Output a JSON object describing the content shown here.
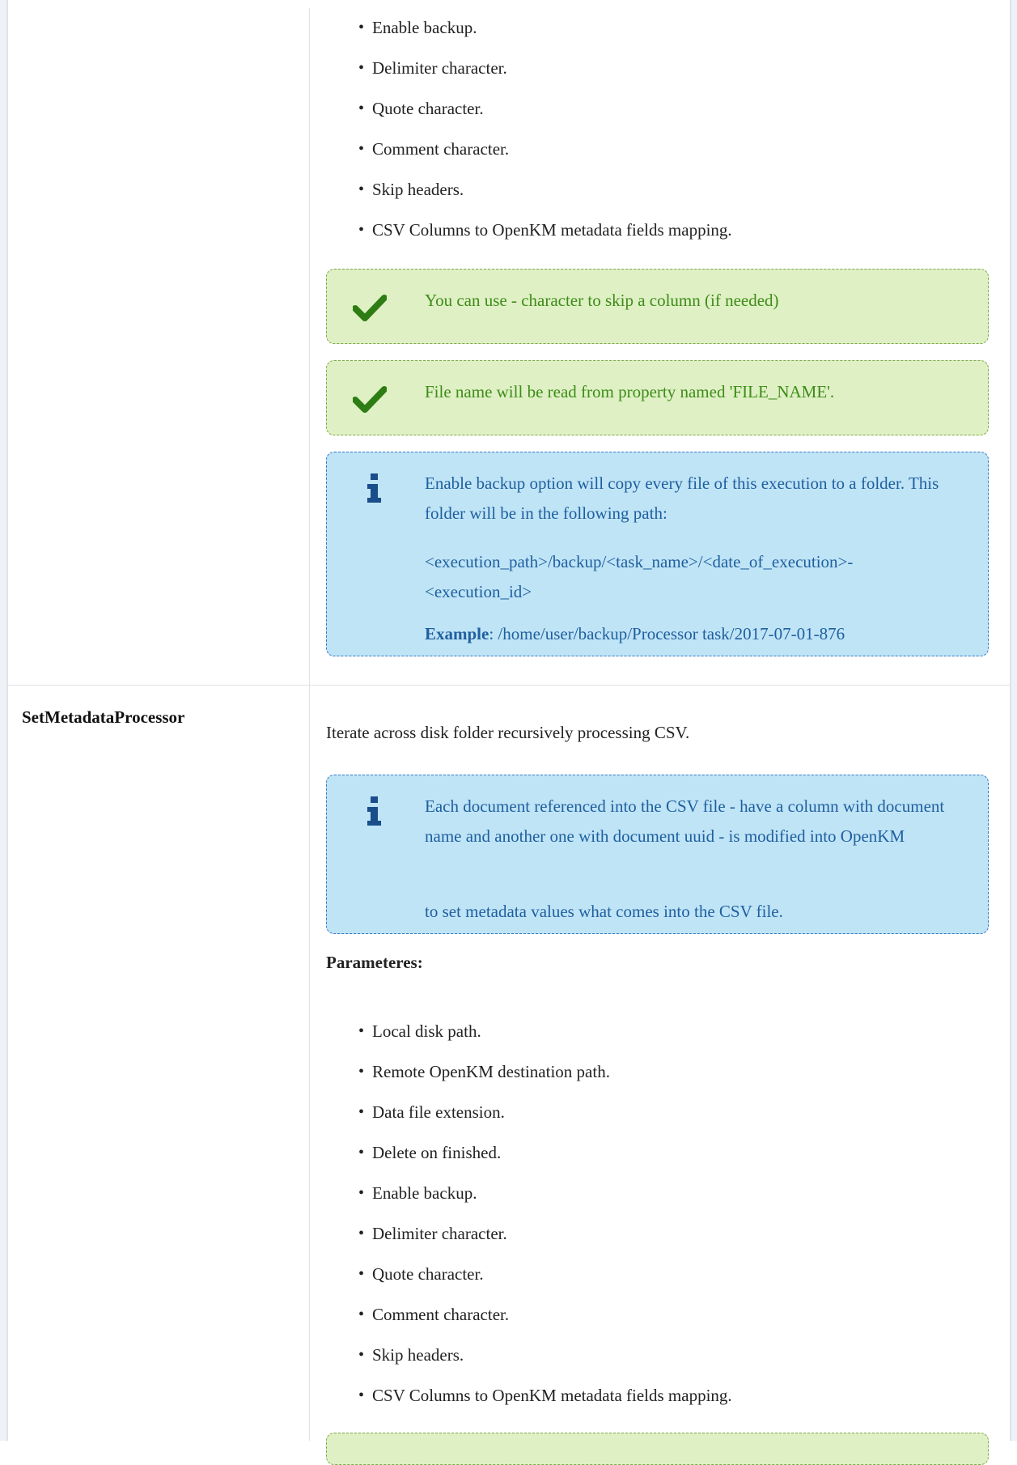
{
  "top_list": [
    "Enable backup.",
    "Delimiter character.",
    "Quote character.",
    "Comment character.",
    "Skip headers.",
    "CSV Columns to OpenKM metadata fields mapping."
  ],
  "notes_top": {
    "success_1": "You can use - character to skip a column (if needed)",
    "success_2": "File name will be read from property named 'FILE_NAME'.",
    "info": {
      "line1": "Enable backup option will copy every file of this execution to a folder. This folder will be in the following path:",
      "line2": "<execution_path>/backup/<task_name>/<date_of_execution>-<execution_id>",
      "example_label": "Example",
      "example_value": ":  /home/user/backup/Processor task/2017-07-01-876"
    }
  },
  "row": {
    "label": "SetMetadataProcessor",
    "description": "Iterate across disk folder recursively processing CSV.",
    "info": {
      "line1": "Each document referenced into the CSV file - have a column with document name and another one with document uuid - is modified into OpenKM",
      "line2": "to set metadata values what comes into the CSV file."
    },
    "params_title": "Parameteres:",
    "params": [
      "Local disk path.",
      "Remote OpenKM destination path.",
      "Data file extension.",
      "Delete on finished.",
      "Enable backup.",
      "Delimiter character.",
      "Quote character.",
      "Comment character.",
      "Skip headers.",
      "CSV Columns to OpenKM metadata fields mapping."
    ]
  },
  "colors": {
    "success_bg": "#dff0c4",
    "success_text": "#3d8c18",
    "info_bg": "#bfe4f6",
    "info_text": "#1f5f9f",
    "icon_check": "#2e7d14",
    "icon_info": "#1a4e8a"
  },
  "icons": {
    "success": "check-icon",
    "info": "info-icon"
  }
}
